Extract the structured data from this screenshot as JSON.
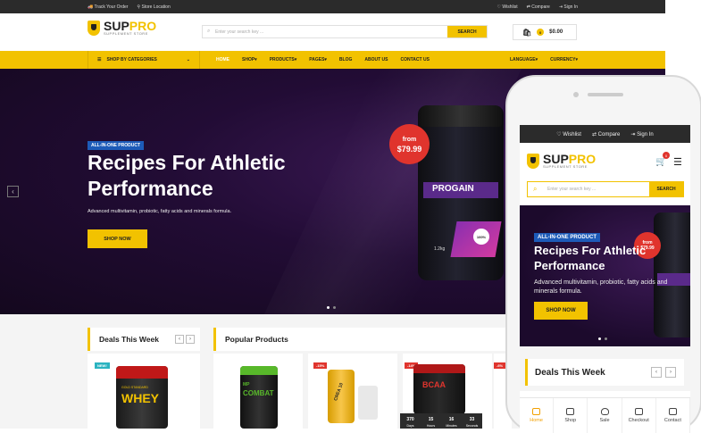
{
  "topbar": {
    "track": "Track Your Order",
    "store": "Store Location",
    "wishlist": "Wishlist",
    "compare": "Compare",
    "signin": "Sign In"
  },
  "brand": {
    "name_a": "SUP",
    "name_b": "PRO",
    "tagline": "SUPPLEMENT STORE",
    "accent": "#f2c200"
  },
  "search": {
    "placeholder": "Enter your search key ...",
    "button": "SEARCH"
  },
  "cart": {
    "count": "0",
    "total": "$0.00"
  },
  "nav": {
    "categories": "SHOP BY CATEGORIES",
    "items": [
      "HOME",
      "SHOP",
      "PRODUCTS",
      "PAGES",
      "BLOG",
      "ABOUT US",
      "CONTACT US"
    ],
    "language": "LANGUAGE",
    "currency": "CURRENCY"
  },
  "hero": {
    "tag": "ALL-IN-ONE PRODUCT",
    "title": "Recipes For Athletic Performance",
    "subtitle": "Advanced multivitamin, probiotic, fatty acids and minerals formula.",
    "cta": "SHOP NOW",
    "price_from": "from",
    "price": "$79.99",
    "product_brand": "PROGAIN",
    "product_weight": "1.2kg",
    "product_percent": "100%"
  },
  "sections": {
    "deals": "Deals This Week",
    "popular": "Popular Products"
  },
  "products": [
    {
      "tag": "NEW!",
      "tag_color": "#2bb3c0",
      "label": "WHEY",
      "line": "GOLD STANDARD"
    },
    {
      "tag": "",
      "tag_color": "",
      "label": "COMBAT",
      "line": "MP"
    },
    {
      "tag": "-15%",
      "tag_color": "#e0342d",
      "label": "CREA 10",
      "line": ""
    },
    {
      "tag": "-14%",
      "tag_color": "#e0342d",
      "label": "BCAA",
      "line": ""
    },
    {
      "tag": "-6%",
      "tag_color": "#e0342d",
      "label": "",
      "line": ""
    }
  ],
  "timer": [
    {
      "value": "370",
      "unit": "Days"
    },
    {
      "value": "15",
      "unit": "Hours"
    },
    {
      "value": "16",
      "unit": "Minutes"
    },
    {
      "value": "33",
      "unit": "Seconds"
    }
  ],
  "phone": {
    "wishlist": "Wishlist",
    "compare": "Compare",
    "signin": "Sign In",
    "cart_count": "0",
    "search_placeholder": "Enter your search key ...",
    "search_button": "SEARCH",
    "hero_tag": "ALL-IN-ONE PRODUCT",
    "hero_title": "Recipes For Athletic Performance",
    "hero_sub": "Advanced multivitamin, probiotic, fatty acids and minerals formula.",
    "cta": "SHOP NOW",
    "price_from": "from",
    "price": "$79.99",
    "deals": "Deals This Week",
    "bottom_nav": [
      "Home",
      "Shop",
      "Sale",
      "Checkout",
      "Contact"
    ]
  }
}
